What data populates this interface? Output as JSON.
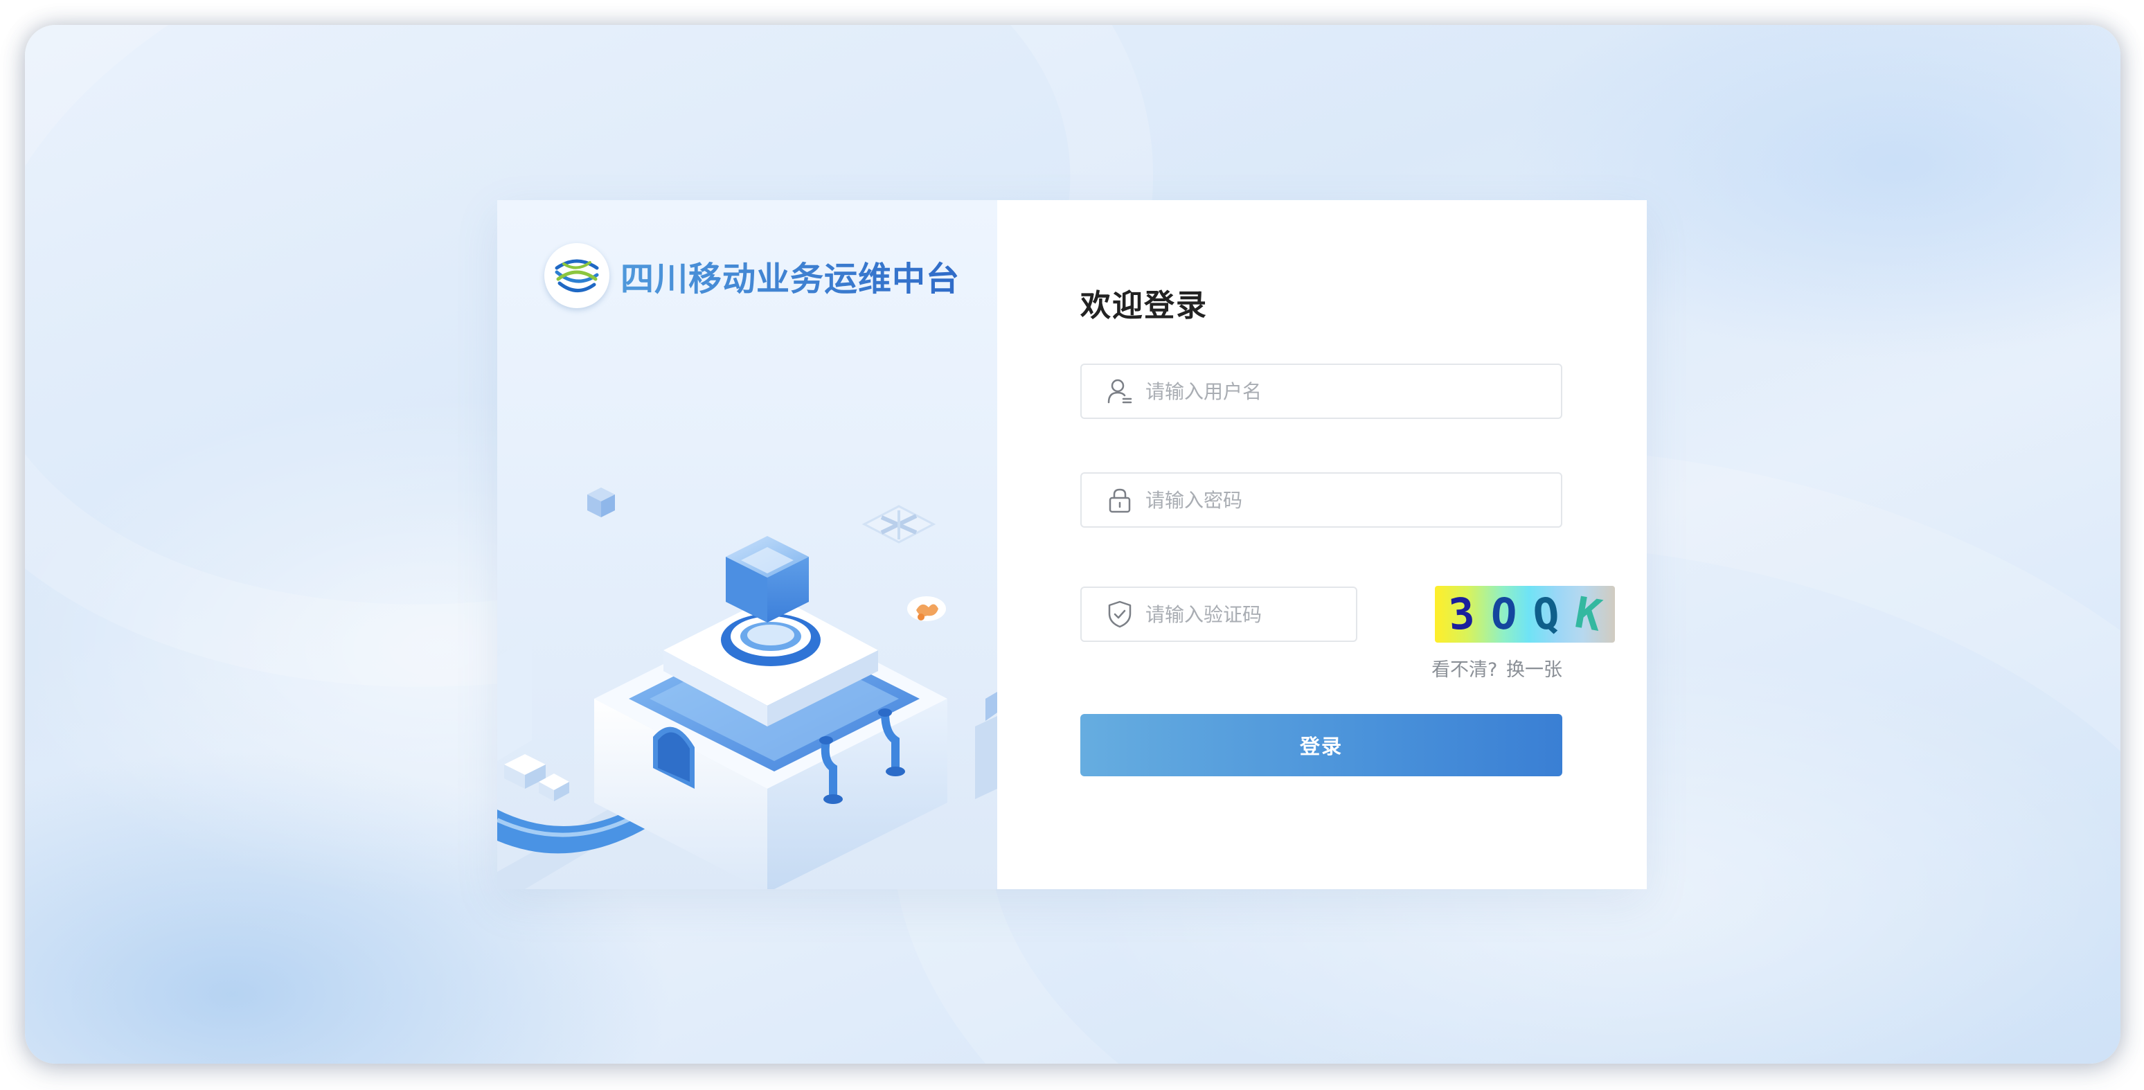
{
  "brand": {
    "title": "四川移动业务运维中台",
    "logo_icon": "china-mobile-logo-icon"
  },
  "login": {
    "welcome": "欢迎登录",
    "username": {
      "placeholder": "请输入用户名",
      "value": "",
      "icon": "user-icon"
    },
    "password": {
      "placeholder": "请输入密码",
      "value": "",
      "icon": "lock-icon"
    },
    "captcha": {
      "placeholder": "请输入验证码",
      "value": "",
      "icon": "shield-check-icon",
      "chars": [
        "3",
        "O",
        "Q",
        "K"
      ],
      "refresh_prompt": "看不清?",
      "refresh_link": "换一张"
    },
    "submit_label": "登录"
  },
  "colors": {
    "brand_blue": "#3b79d0",
    "button_start": "#66ade0",
    "button_end": "#3a7fd4"
  }
}
